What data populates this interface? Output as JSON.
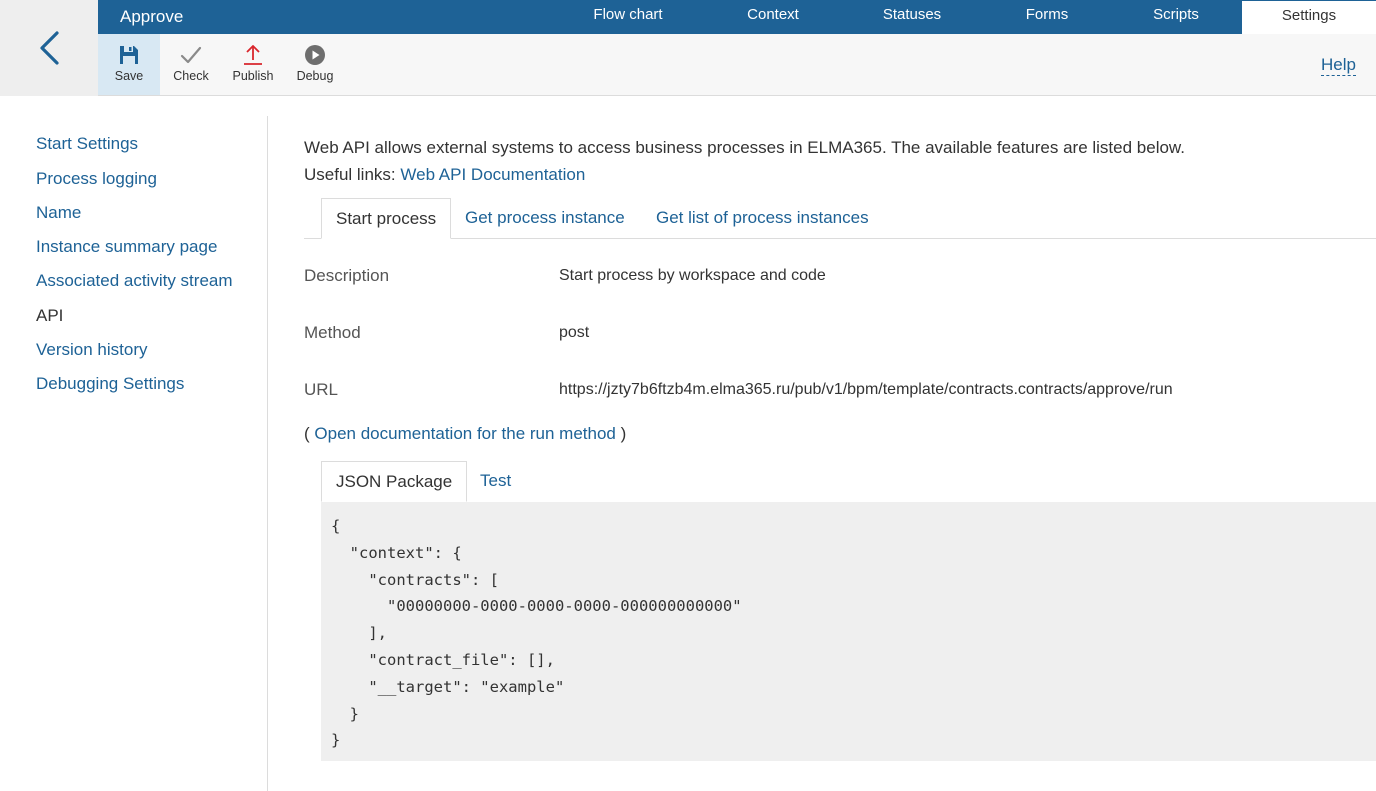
{
  "header": {
    "title": "Approve",
    "nav": [
      {
        "label": "Flow chart"
      },
      {
        "label": "Context"
      },
      {
        "label": "Statuses"
      },
      {
        "label": "Forms"
      },
      {
        "label": "Scripts"
      },
      {
        "label": "Settings",
        "active": true
      }
    ]
  },
  "toolbar": {
    "save_label": "Save",
    "check_label": "Check",
    "publish_label": "Publish",
    "debug_label": "Debug",
    "help_label": "Help"
  },
  "sidebar": {
    "items": [
      {
        "label": "Start Settings"
      },
      {
        "label": "Process logging"
      },
      {
        "label": "Name"
      },
      {
        "label": "Instance summary page"
      },
      {
        "label": "Associated activity stream"
      },
      {
        "label": "API",
        "current": true
      },
      {
        "label": "Version history"
      },
      {
        "label": "Debugging Settings"
      }
    ]
  },
  "main": {
    "intro": "Web API allows external systems to access business processes in ELMA365. The available features are listed below.",
    "useful_links_label": "Useful links:",
    "doc_link": "Web API Documentation",
    "api_tabs": [
      {
        "label": "Start process",
        "active": true
      },
      {
        "label": "Get process instance"
      },
      {
        "label": "Get list of process instances"
      }
    ],
    "fields": {
      "description_label": "Description",
      "description_value": "Start process by workspace and code",
      "method_label": "Method",
      "method_value": "post",
      "url_label": "URL",
      "url_value": "https://jzty7b6ftzb4m.elma365.ru/pub/v1/bpm/template/contracts.contracts/approve/run"
    },
    "run_doc": {
      "open_paren": "(",
      "link": "Open documentation for the run method",
      "close_paren": ")"
    },
    "code_tabs": [
      {
        "label": "JSON Package",
        "active": true
      },
      {
        "label": "Test"
      }
    ],
    "code": "{\n  \"context\": {\n    \"contracts\": [\n      \"00000000-0000-0000-0000-000000000000\"\n    ],\n    \"contract_file\": [],\n    \"__target\": \"example\"\n  }\n}"
  },
  "colors": {
    "brand": "#1e6296",
    "publish_accent": "#d9262c",
    "toolbar_active": "#d8e8f3"
  }
}
